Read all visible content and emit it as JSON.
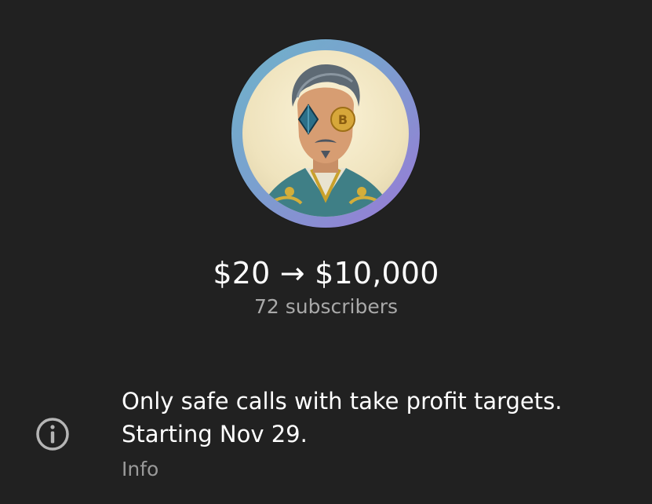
{
  "channel": {
    "title": "$20 → $10,000",
    "subscribers": "72 subscribers",
    "avatar_icon": "channel-avatar"
  },
  "info": {
    "description_line1": "Only safe calls with take profit targets.",
    "description_line2": "Starting Nov 29.",
    "label": "Info",
    "icon": "info-icon"
  },
  "colors": {
    "background": "#212121",
    "primary_text": "#ffffff",
    "secondary_text": "#a9a9a9"
  }
}
